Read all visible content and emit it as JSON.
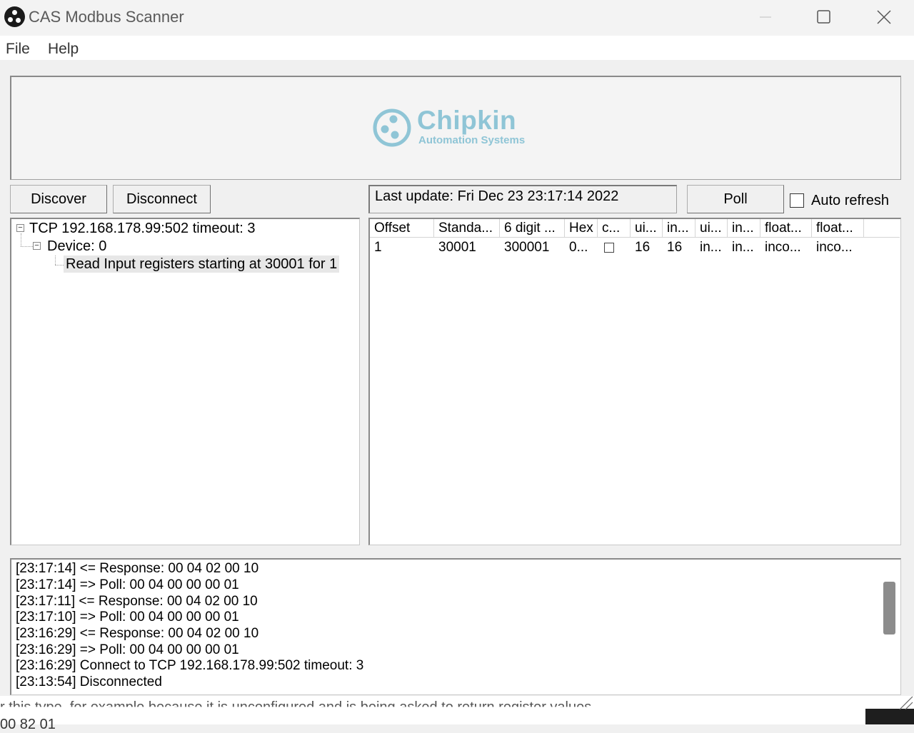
{
  "window": {
    "title": "CAS Modbus Scanner"
  },
  "menu": {
    "file": "File",
    "help": "Help"
  },
  "banner": {
    "brand": "Chipkin",
    "tagline": "Automation Systems",
    "brand_color": "#8fc5d6"
  },
  "toolbar": {
    "discover": "Discover",
    "disconnect": "Disconnect",
    "last_update": "Last update: Fri Dec 23 23:17:14 2022",
    "poll": "Poll",
    "auto_refresh": "Auto refresh",
    "auto_refresh_checked": false
  },
  "tree": {
    "connection": "TCP 192.168.178.99:502 timeout: 3",
    "device": "Device: 0",
    "request": "Read Input registers starting at 30001 for 1"
  },
  "table": {
    "columns": [
      "Offset",
      "Standa...",
      "6 digit ...",
      "Hex",
      "c...",
      "ui...",
      "in...",
      "ui...",
      "in...",
      "float...",
      "float..."
    ],
    "rows": [
      [
        "1",
        "30001",
        "300001",
        "0...",
        "",
        "16",
        "16",
        "in...",
        "in...",
        "inco...",
        "inco..."
      ]
    ]
  },
  "log": [
    "[23:17:14] <= Response: 00 04 02 00 10",
    "[23:17:14] => Poll: 00 04 00 00 00 01",
    "[23:17:11] <= Response: 00 04 02 00 10",
    "[23:17:10] => Poll: 00 04 00 00 00 01",
    "[23:16:29] <= Response: 00 04 02 00 10",
    "[23:16:29] => Poll: 00 04 00 00 00 01",
    "[23:16:29] Connect to TCP 192.168.178.99:502 timeout: 3",
    "[23:13:54] Disconnected"
  ],
  "background": {
    "line1": "r this type, for example because it is unconfigured and is being asked to return register values.",
    "line2": "00 82 01"
  }
}
